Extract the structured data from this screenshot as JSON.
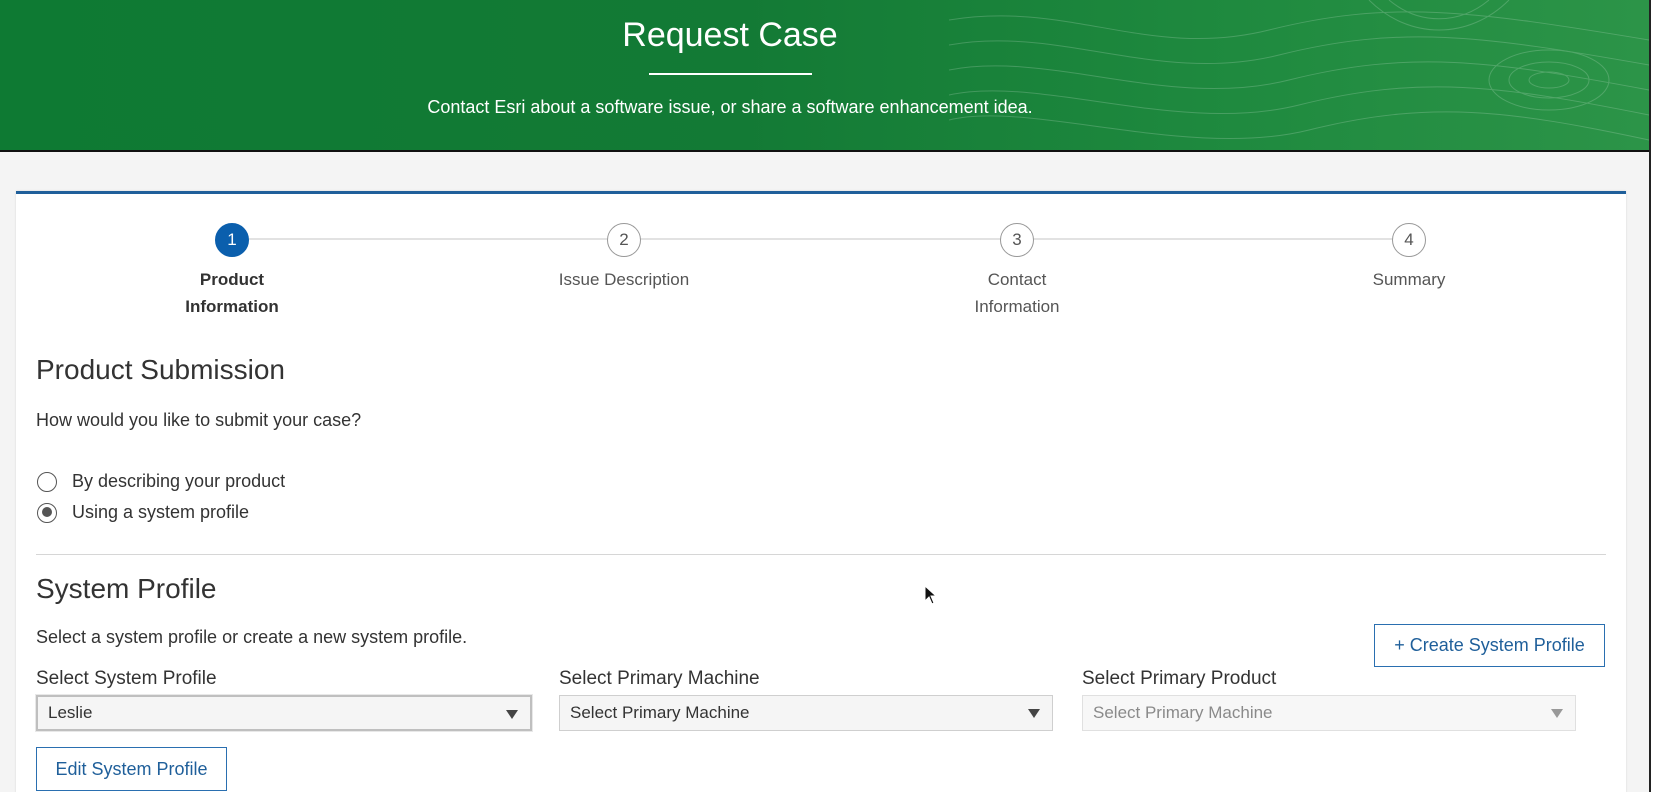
{
  "header": {
    "title": "Request Case",
    "subtitle": "Contact Esri about a software issue, or share a software enhancement idea."
  },
  "stepper": {
    "steps": [
      {
        "number": "1",
        "label_line1": "Product",
        "label_line2": "Information",
        "active": true
      },
      {
        "number": "2",
        "label_line1": "Issue Description",
        "label_line2": "",
        "active": false
      },
      {
        "number": "3",
        "label_line1": "Contact",
        "label_line2": "Information",
        "active": false
      },
      {
        "number": "4",
        "label_line1": "Summary",
        "label_line2": "",
        "active": false
      }
    ]
  },
  "product_submission": {
    "heading": "Product Submission",
    "question": "How would you like to submit your case?",
    "options": [
      {
        "label": "By describing your product",
        "selected": false
      },
      {
        "label": "Using a system profile",
        "selected": true
      }
    ]
  },
  "system_profile": {
    "heading": "System Profile",
    "instruction": "Select a system profile or create a new system profile.",
    "create_button": "+ Create System Profile",
    "edit_button": "Edit System Profile",
    "fields": {
      "profile": {
        "label": "Select System Profile",
        "value": "Leslie"
      },
      "machine": {
        "label": "Select Primary Machine",
        "value": "Select Primary Machine"
      },
      "product": {
        "label": "Select Primary Product",
        "value": "Select Primary Machine"
      }
    }
  },
  "icons": {
    "caret": "chevron-down-icon",
    "cursor": "mouse-pointer-icon"
  },
  "colors": {
    "banner_green": "#137a35",
    "accent_blue": "#0b5fad",
    "card_top_border": "#1f5f9a"
  }
}
